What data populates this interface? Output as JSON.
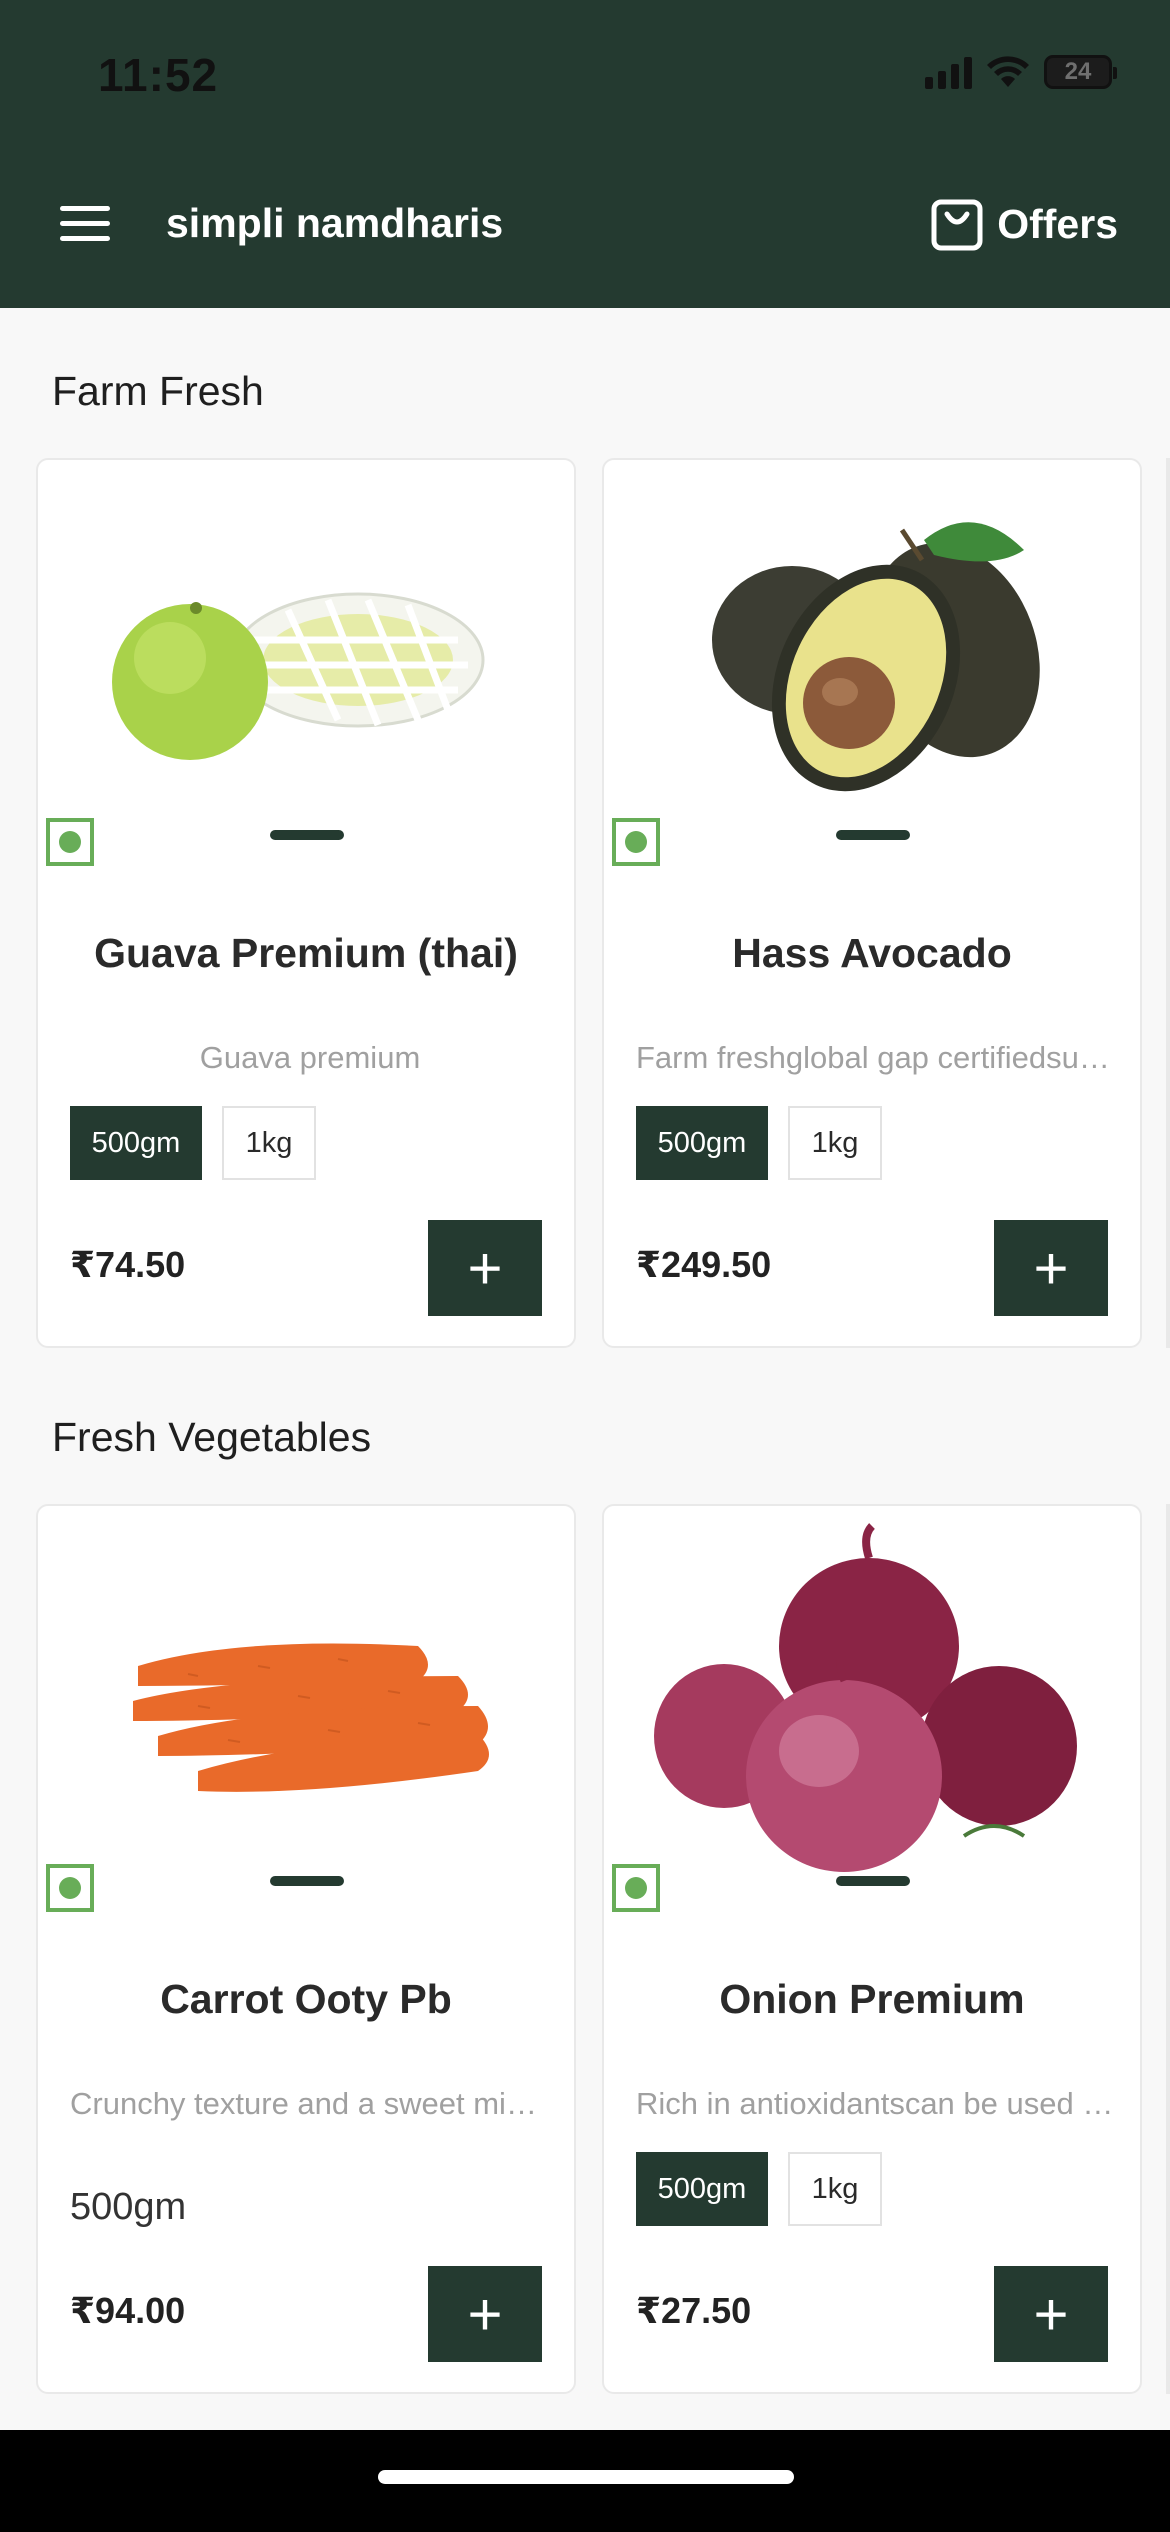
{
  "status_bar": {
    "time": "11:52",
    "battery": "24"
  },
  "header": {
    "app_title": "simpli namdharis",
    "offers_label": "Offers"
  },
  "sections": [
    {
      "title": "Farm Fresh",
      "products": [
        {
          "name": "Guava Premium (thai)",
          "description": "Guava premium",
          "sizes": [
            "500gm",
            "1kg"
          ],
          "selected_size": "500gm",
          "price": "₹74.50"
        },
        {
          "name": "Hass Avocado",
          "description": "Farm freshglobal gap certifiedsup...",
          "sizes": [
            "500gm",
            "1kg"
          ],
          "selected_size": "500gm",
          "price": "₹249.50"
        }
      ]
    },
    {
      "title": "Fresh Vegetables",
      "products": [
        {
          "name": "Carrot Ooty Pb",
          "description": "Crunchy texture and a sweet mint...",
          "size_text": "500gm",
          "price": "₹94.00"
        },
        {
          "name": "Onion Premium",
          "description": "Rich in antioxidantscan be used in ...",
          "sizes": [
            "500gm",
            "1kg"
          ],
          "selected_size": "500gm",
          "price": "₹27.50"
        }
      ]
    }
  ],
  "add_button_label": "+",
  "icons": {
    "menu": "hamburger-icon",
    "offers": "shopping-bag-icon",
    "veg": "veg-indicator-icon"
  },
  "colors": {
    "brand_dark_green": "#243a30",
    "veg_green": "#68ad58",
    "muted_text": "#a0a0a0"
  }
}
